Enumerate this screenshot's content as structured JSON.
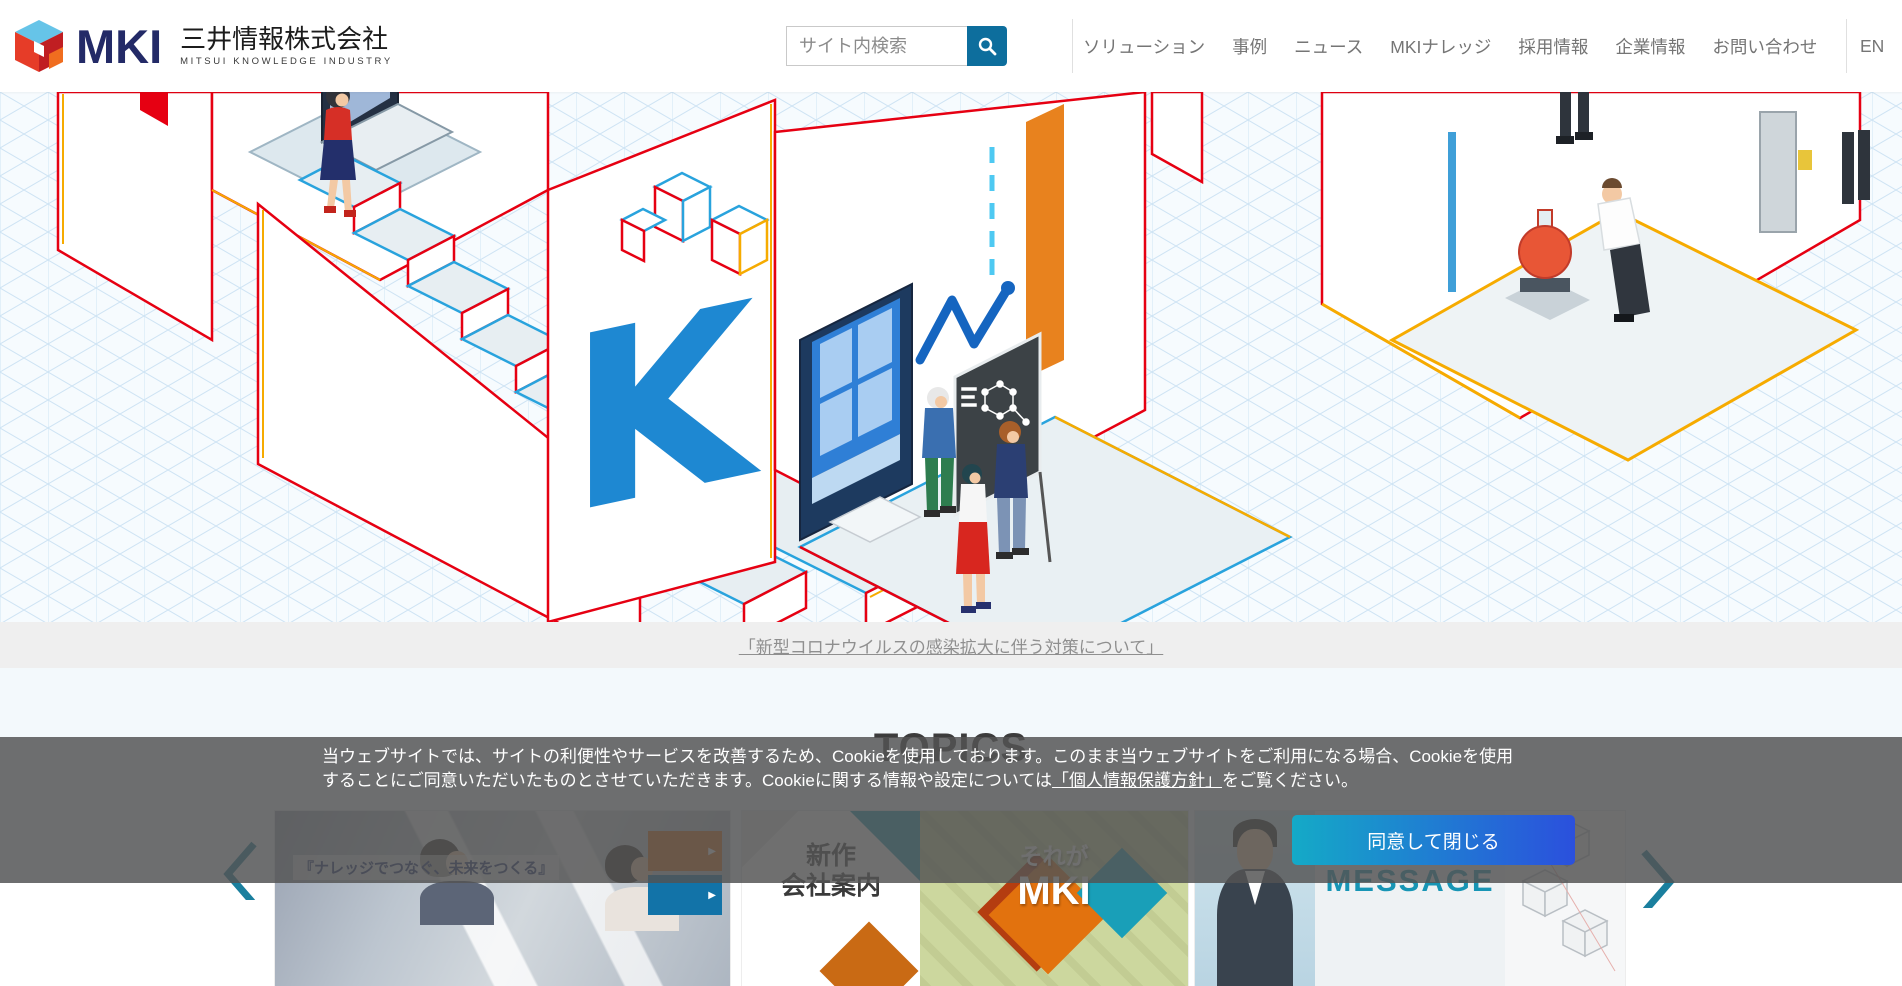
{
  "header": {
    "logo": {
      "mki": "MKI",
      "company": "三井情報株式会社",
      "company_en": "MITSUI KNOWLEDGE INDUSTRY"
    },
    "search": {
      "placeholder": "サイト内検索"
    },
    "nav": [
      "ソリューション",
      "事例",
      "ニュース",
      "MKIナレッジ",
      "採用情報",
      "企業情報",
      "お問い合わせ"
    ],
    "lang": "EN"
  },
  "hero": {
    "k_letter": "K"
  },
  "notice": {
    "link": "「新型コロナウイルスの感染拡大に伴う対策について」"
  },
  "topics": {
    "title": "TOPICS",
    "cards": [
      {
        "caption": "『ナレッジでつなぐ、未来をつくる』",
        "arrow": "▶"
      },
      {
        "left1": "新作",
        "left2": "会社案内",
        "right1": "それが",
        "right2": "MKI"
      },
      {
        "title": "MESSAGE"
      }
    ]
  },
  "cookie": {
    "line1": "当ウェブサイトでは、サイトの利便性やサービスを改善するため、Cookieを使用しております。このまま当ウェブサイトをご利用になる場合、Cookieを使用",
    "line2a": "することにご同意いただいたものとさせていただきます。Cookieに関する情報や設定については",
    "link": "「個人情報保護方針」",
    "line2b": "をご覧ください。",
    "button": "同意して閉じる"
  },
  "colors": {
    "search_button": "#0d6e9d",
    "outline_red": "#e60012",
    "outline_yellow": "#f6ab00",
    "outline_blue": "#29a3dd",
    "k_blue": "#1e88d2",
    "orange_panel": "#e8821e",
    "overlay_gray": "rgba(84,84,84,0.84)",
    "accept_gradient_start": "#14aac7",
    "accept_gradient_end": "#2b50dd"
  }
}
